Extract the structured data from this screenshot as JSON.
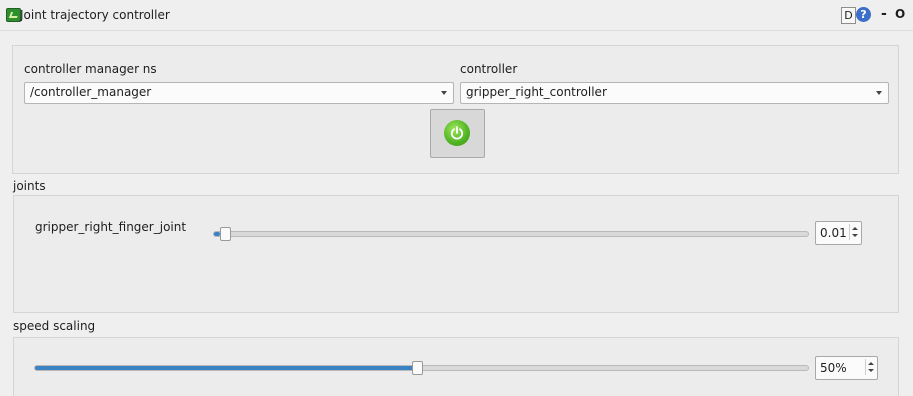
{
  "window": {
    "title": "Joint trajectory controller",
    "d_button": "D",
    "help_button": "?",
    "min_button": "-",
    "close_button": "O"
  },
  "controls": {
    "ns_label": "controller manager ns",
    "ns_value": "/controller_manager",
    "controller_label": "controller",
    "controller_value": "gripper_right_controller",
    "power_icon": "power-icon",
    "power_color": "#55b52a"
  },
  "joints": {
    "section_label": "joints",
    "items": [
      {
        "name": "gripper_right_finger_joint",
        "value": "0.01"
      }
    ]
  },
  "speed": {
    "section_label": "speed scaling",
    "value": "50%",
    "fraction": 0.5
  }
}
